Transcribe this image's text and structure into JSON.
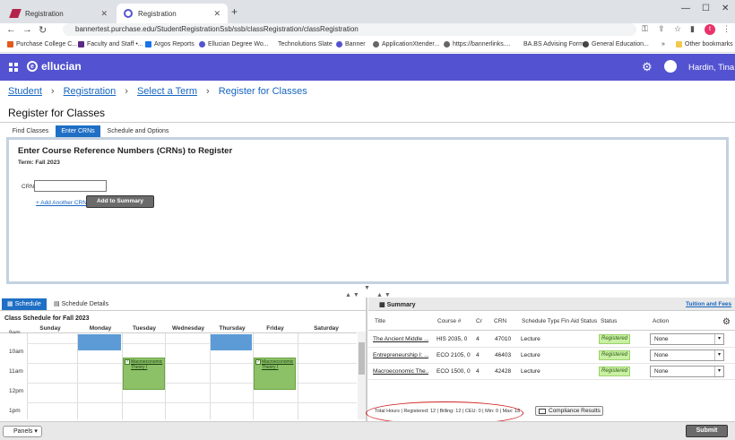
{
  "browser": {
    "tabs": [
      {
        "title": "Registration",
        "active": false
      },
      {
        "title": "Registration",
        "active": true
      }
    ],
    "url": "bannertest.purchase.edu/StudentRegistrationSsb/ssb/classRegistration/classRegistration",
    "profile_initial": "t",
    "bookmarks": [
      "Purchase College C...",
      "Faculty and Staff •...",
      "Argos Reports",
      "Ellucian Degree Wo...",
      "Technolutions Slate",
      "Banner",
      "ApplicationXtender...",
      "https://bannerlinks....",
      "BA.BS Advising Form",
      "General Education...",
      "Other bookmarks"
    ],
    "bookmarks_more": "»"
  },
  "app": {
    "brand": "ellucian",
    "user_name": "Hardin, Tina",
    "colors": {
      "header": "#5353d1",
      "accent": "#1f6fc5",
      "registered": "#c9f0a3"
    }
  },
  "breadcrumb": [
    "Student",
    "Registration",
    "Select a Term",
    "Register for Classes"
  ],
  "page_title": "Register for Classes",
  "page_tabs": [
    "Find Classes",
    "Enter CRNs",
    "Schedule and Options"
  ],
  "crn_panel": {
    "heading": "Enter Course Reference Numbers (CRNs) to Register",
    "term": "Term: Fall 2023",
    "crn_label": "CRN:",
    "crn_value": "",
    "add_another": "+ Add Another CRN",
    "add_to_summary": "Add to Summary"
  },
  "schedule": {
    "tabs": [
      "Schedule",
      "Schedule Details"
    ],
    "title": "Class Schedule for Fall 2023",
    "days": [
      "Sunday",
      "Monday",
      "Tuesday",
      "Wednesday",
      "Thursday",
      "Friday",
      "Saturday"
    ],
    "times": [
      "9am",
      "10am",
      "11am",
      "12pm",
      "1pm"
    ],
    "events": [
      {
        "day": "Tuesday",
        "label": "Macroeconomic Theory I"
      },
      {
        "day": "Friday",
        "label": "Macroeconomic Theory I"
      }
    ]
  },
  "summary": {
    "title": "Summary",
    "tuition_link": "Tuition and Fees",
    "columns": [
      "Title",
      "Course #",
      "Cr",
      "CRN",
      "Schedule Type",
      "Fin Aid Status",
      "Status",
      "Action"
    ],
    "rows": [
      {
        "title": "The Ancient Middle ...",
        "course": "HIS 2035, 0",
        "cr": "4",
        "crn": "47010",
        "type": "Lecture",
        "status": "Registered",
        "action": "None"
      },
      {
        "title": "Entrepreneurship I: ...",
        "course": "ECO 2105, 0",
        "cr": "4",
        "crn": "46403",
        "type": "Lecture",
        "status": "Registered",
        "action": "None"
      },
      {
        "title": "Macroeconomic The...",
        "course": "ECO 1500, 0",
        "cr": "4",
        "crn": "42428",
        "type": "Lecture",
        "status": "Registered",
        "action": "None"
      }
    ],
    "totals_label": "Total Hours |",
    "totals_text": "Registered: 12 | Billing: 12 | CEU: 0 | Min: 0 | Max: 18",
    "compliance_button": "Compliance Results"
  },
  "footer": {
    "panels": "Panels",
    "submit": "Submit"
  }
}
